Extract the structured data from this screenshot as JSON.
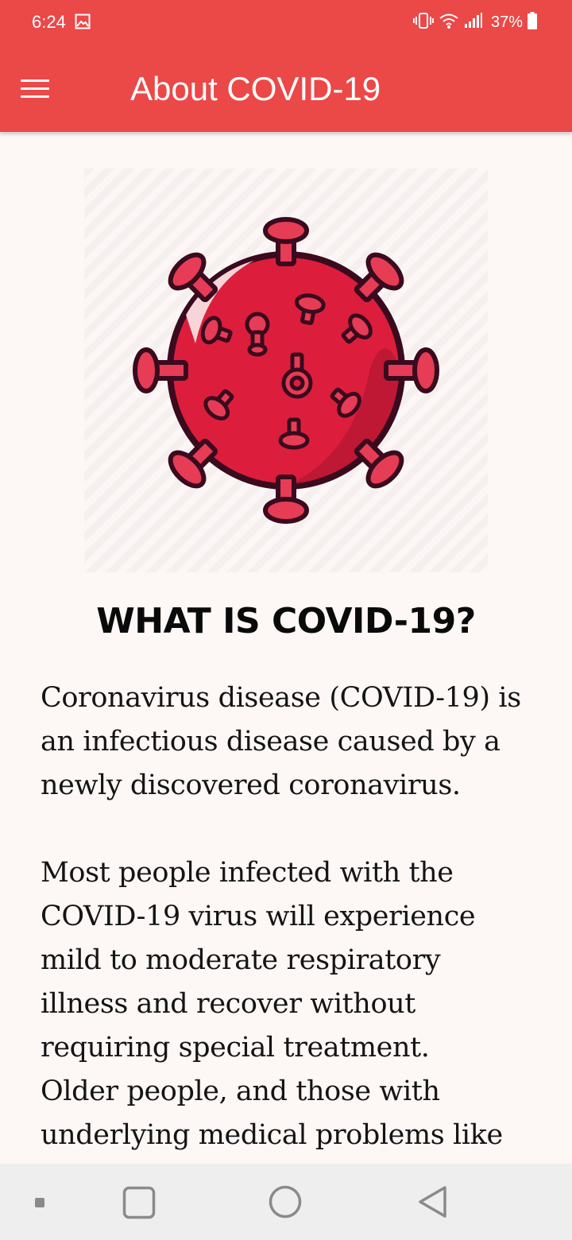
{
  "status_bar": {
    "time": "6:24",
    "battery_percent": "37%",
    "icons": [
      "gallery-icon",
      "vibrate-icon",
      "wifi-icon",
      "signal-icon",
      "battery-icon"
    ]
  },
  "app_bar": {
    "title": "About COVID-19",
    "menu_icon": "hamburger-menu-icon",
    "color": "#eb4848"
  },
  "content": {
    "hero_image": "coronavirus-illustration",
    "heading": "WHAT IS COVID-19?",
    "paragraph_1_lines": [
      "Coronavirus disease (COVID-19) is",
      "an infectious disease caused by a",
      "newly discovered coronavirus."
    ],
    "paragraph_2_lines": [
      "Most people infected with the",
      "COVID-19 virus will experience",
      "mild to moderate respiratory",
      "illness and recover without",
      "requiring special treatment.",
      "Older people, and those with",
      "underlying medical problems like"
    ]
  },
  "nav_bar": {
    "items": [
      "recents-dot-icon",
      "overview-square-icon",
      "home-circle-icon",
      "back-triangle-icon"
    ]
  },
  "colors": {
    "accent": "#eb4848",
    "virus_body": "#dc1e3c",
    "virus_outline": "#3a0a1e",
    "background": "#fdf7f6"
  }
}
